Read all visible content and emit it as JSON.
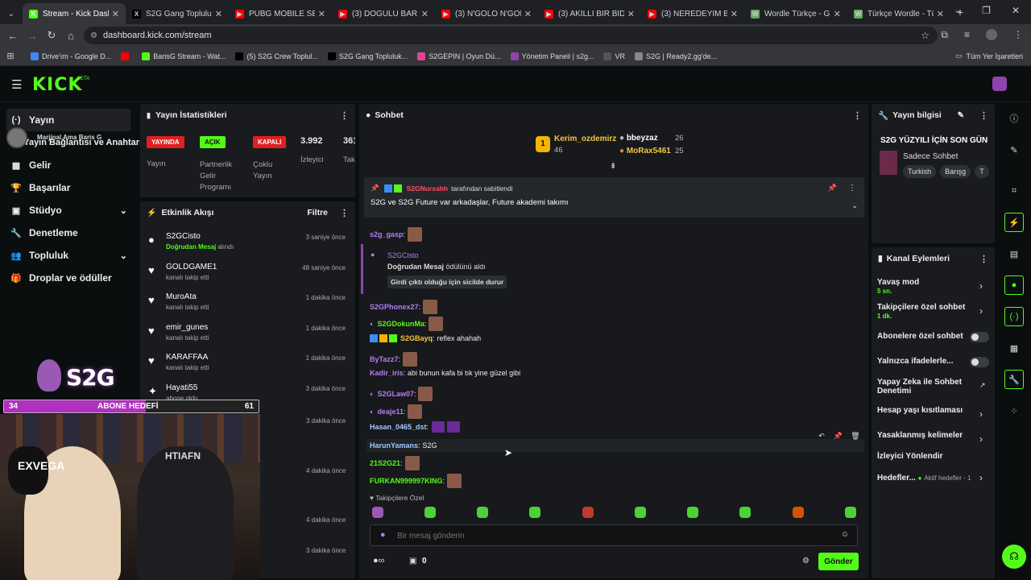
{
  "browser": {
    "tabs": [
      {
        "title": "Stream - Kick Dashb",
        "color": "#53fc18",
        "glyph": "K",
        "active": true
      },
      {
        "title": "S2G Gang Topluluk /",
        "color": "#000000",
        "glyph": "X"
      },
      {
        "title": "PUBG MOBILE SE",
        "color": "#ff0000",
        "glyph": "▶"
      },
      {
        "title": "(3) DOĞULU BARIŞ G",
        "color": "#ff0000",
        "glyph": "▶"
      },
      {
        "title": "(3) N'GOLO N'GOLO",
        "color": "#ff0000",
        "glyph": "▶"
      },
      {
        "title": "(3) AKILLI BİR BIDIK |",
        "color": "#ff0000",
        "glyph": "▶"
      },
      {
        "title": "(3) NEREDEYİM BEN",
        "color": "#ff0000",
        "glyph": "▶"
      },
      {
        "title": "Wordle Türkçe - Gün",
        "color": "#6aaa64",
        "glyph": "W"
      },
      {
        "title": "Türkçe Wordle - Türk",
        "color": "#6aaa64",
        "glyph": "W"
      }
    ],
    "url": "dashboard.kick.com/stream",
    "bookmarks": [
      {
        "label": "Drive'ım - Google D...",
        "color": "#4285f4"
      },
      {
        "label": "",
        "color": "#ff0000"
      },
      {
        "label": "BarisG Stream - Wat...",
        "color": "#53fc18"
      },
      {
        "label": "(5) S2G Crew Toplul...",
        "color": "#000000"
      },
      {
        "label": "S2G Gang Topluluk...",
        "color": "#000000"
      },
      {
        "label": "S2GEPIN | Oyun Dü...",
        "color": "#e84393"
      },
      {
        "label": "Yönetim Paneli | s2g...",
        "color": "#8e44ad"
      },
      {
        "label": "VR",
        "color": "#555555"
      },
      {
        "label": "S2G | Ready2.gg'de...",
        "color": "#888888"
      }
    ],
    "bookmarks_folder": "Tüm Yer İşaretleri"
  },
  "kick": {
    "logo": "KICK",
    "beta": "BETA"
  },
  "sidebar": {
    "items": [
      {
        "label": "Yayın",
        "icon": "(·)"
      },
      {
        "label": "Yayın Bağlantısı ve Anahtarı",
        "icon": "⚯"
      },
      {
        "label": "Gelir",
        "icon": "▦"
      },
      {
        "label": "Başarılar",
        "icon": "🏆"
      },
      {
        "label": "Stüdyo",
        "icon": "▣"
      },
      {
        "label": "Denetleme",
        "icon": "🔧"
      },
      {
        "label": "Topluluk",
        "icon": "👥"
      },
      {
        "label": "Droplar ve ödüller",
        "icon": "🎁"
      }
    ],
    "overlay_name": "Marjinal Ama Baris G"
  },
  "stats": {
    "title": "Yayın İstatistikleri",
    "live_badge": "YAYINDA",
    "live_label": "Yayın",
    "partner_badge": "AÇIK",
    "partner_label": "Partnerlik Gelir Programı",
    "multi_badge": "KAPALI",
    "multi_label": "Çoklu Yayın",
    "viewers": "3.992",
    "viewers_label": "İzleyici",
    "followers": "361.",
    "followers_label": "Taki"
  },
  "feed": {
    "title": "Etkinlik Akışı",
    "filter": "Filtre",
    "items": [
      {
        "name": "S2GCisto",
        "sub_hl": "Doğrudan Mesaj",
        "sub": "alındı",
        "time": "3 saniye önce",
        "icon": "●"
      },
      {
        "name": "GOLDGAME1",
        "sub": "kanalı takip etti",
        "time": "48 saniye önce",
        "icon": "♥"
      },
      {
        "name": "MuroAta",
        "sub": "kanalı takip etti",
        "time": "1 dakika önce",
        "icon": "♥"
      },
      {
        "name": "emir_gunes",
        "sub": "kanalı takip etti",
        "time": "1 dakika önce",
        "icon": "♥"
      },
      {
        "name": "KARAFFAA",
        "sub": "kanalı takip etti",
        "time": "1 dakika önce",
        "icon": "♥"
      },
      {
        "name": "Hayati55",
        "sub": "abone oldu",
        "time": "3 dakika önce",
        "icon": "✦"
      }
    ],
    "hidden_times": [
      "3 dakika önce",
      "4 dakika önce",
      "4 dakika önce",
      "3 dakika önce"
    ]
  },
  "overlay": {
    "sub_goal_label": "ABONE HEDEFİ",
    "sub_current": "34",
    "sub_target": "61",
    "brand": "S2G"
  },
  "chat": {
    "title": "Sohbet",
    "leaders": [
      {
        "name": "Kerim_ozdemirz",
        "count": "46",
        "rank": "1"
      },
      {
        "name": "bbeyzaz",
        "count": "26"
      },
      {
        "name": "MoRax5461",
        "count": "25"
      }
    ],
    "pinned_by_user": "S2GNursahh",
    "pinned_by_suffix": "tarafından sabitlendi",
    "pinned_text": "S2G ve S2G Future var arkadaşlar, Future akademi takımı",
    "messages": [
      {
        "user": "s2g_gasp",
        "color": "#b57cf5",
        "text": "",
        "emote": true
      },
      {
        "user": "S2GPhonex27",
        "color": "#b57cf5",
        "text": "",
        "emote": true
      },
      {
        "user": "S2GDokunMa",
        "color": "#53fc18",
        "text": "",
        "emote": true
      },
      {
        "user": "S2GBayq",
        "color": "#f5c542",
        "text": "reflex ahahah",
        "emote": false
      },
      {
        "user": "ByTazz7",
        "color": "#b57cf5",
        "text": "",
        "emote": true
      },
      {
        "user": "Kadir_iris",
        "color": "#b57cf5",
        "text": "abi bunun kafa bi tık yine güzel gibi",
        "emote": false
      },
      {
        "user": "S2GLaw07",
        "color": "#b57cf5",
        "text": "",
        "emote": true
      },
      {
        "user": "deaje11",
        "color": "#b57cf5",
        "text": "",
        "emote": true
      },
      {
        "user": "Hasan_0465_dst",
        "color": "#9ecbff",
        "text": "",
        "emote": false
      },
      {
        "user": "HarunYamans",
        "color": "#9ecbff",
        "text": "S2G",
        "emote": false
      },
      {
        "user": "21S2G21",
        "color": "#53fc18",
        "text": "",
        "emote": true
      },
      {
        "user": "FURKAN999997KING",
        "color": "#53fc18",
        "text": "",
        "emote": true
      }
    ],
    "reward": {
      "user": "S2GCisto",
      "line_hl": "Doğrudan Mesaj",
      "line": "ödülünü aldı",
      "message": "Girdi çıktı olduğu için sicilde durur"
    },
    "followers_only": "Takipçilere Özel",
    "input_placeholder": "Bir mesaj gönderin",
    "points": "0",
    "send": "Gönder"
  },
  "info": {
    "title": "Yayın bilgisi",
    "stream_title": "S2G YÜZYILI İÇİN SON GÜN",
    "category": "Sadece Sohbet",
    "tags": [
      "Turkish",
      "Barışg",
      "T"
    ]
  },
  "actions": {
    "title": "Kanal Eylemleri",
    "items": [
      {
        "label": "Yavaş mod",
        "sub": "5 sn.",
        "kind": "chev"
      },
      {
        "label": "Takipçilere özel sohbet",
        "sub": "1 dk.",
        "kind": "chev"
      },
      {
        "label": "Abonelere özel sohbet",
        "sub": "",
        "kind": "toggle"
      },
      {
        "label": "Yalnızca ifadelerle...",
        "sub": "",
        "kind": "toggle"
      },
      {
        "label": "Yapay Zeka ile Sohbet Denetimi",
        "sub": "",
        "kind": "ext"
      },
      {
        "label": "Hesap yaşı kısıtlaması",
        "sub": "",
        "kind": "chev"
      },
      {
        "label": "Yasaklanmış kelimeler",
        "sub": "",
        "kind": "chev"
      },
      {
        "label": "İzleyici Yönlendir",
        "sub": "",
        "kind": "none"
      },
      {
        "label": "Hedefler...",
        "sub": "Aktif hedefler - 1",
        "kind": "chev"
      }
    ]
  }
}
